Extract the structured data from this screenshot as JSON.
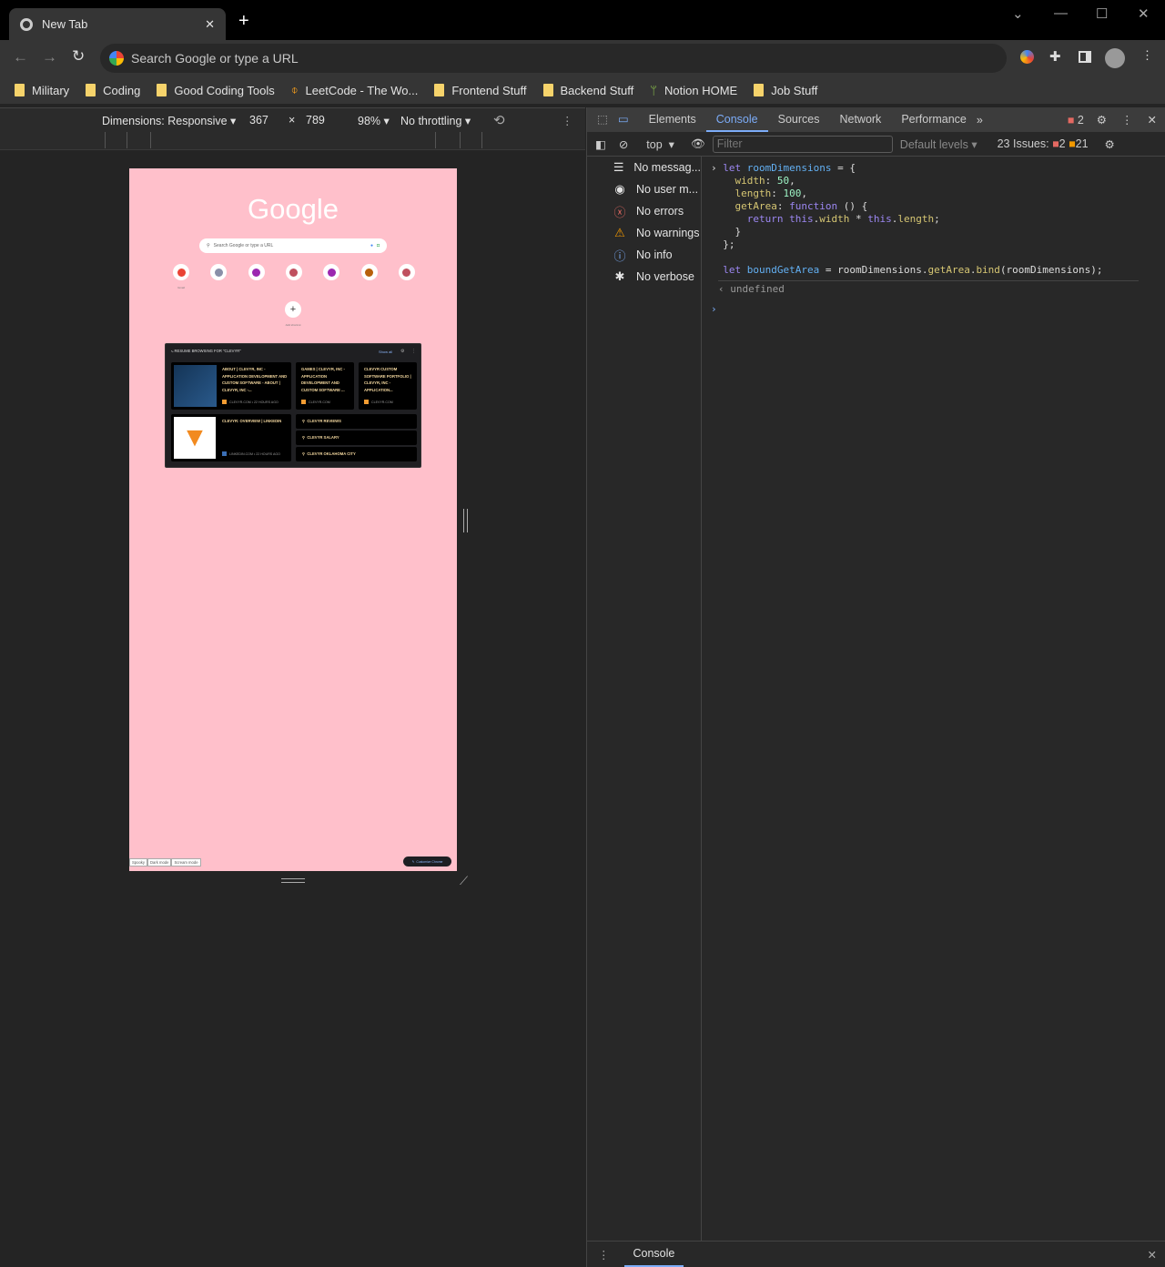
{
  "browser": {
    "tab_title": "New Tab",
    "omnibox_placeholder": "Search Google or type a URL",
    "bookmarks": [
      "Military",
      "Coding",
      "Good Coding Tools",
      "LeetCode - The Wo...",
      "Frontend Stuff",
      "Backend Stuff",
      "Notion HOME",
      "Job Stuff"
    ]
  },
  "device_toolbar": {
    "dimensions": "Dimensions: Responsive",
    "width": "367",
    "x": "×",
    "height": "789",
    "zoom": "98%",
    "throttling": "No throttling"
  },
  "page": {
    "logo": "Google",
    "search_placeholder": "Search Google or type a URL",
    "shortcuts": [
      {
        "label": "Gmail",
        "color": "#ea4335"
      },
      {
        "label": "",
        "color": "#8a8fa8"
      },
      {
        "label": "",
        "color": "#9c27b0"
      },
      {
        "label": "",
        "color": "#c0505f"
      },
      {
        "label": "",
        "color": "#9c27b0"
      },
      {
        "label": "",
        "color": "#b8600c"
      },
      {
        "label": "",
        "color": "#c0505f"
      }
    ],
    "add_shortcut": "Add shortcut",
    "resume": {
      "title": "RESUME BROWSING FOR \"CLEVYR\"",
      "show_all": "Show all",
      "items": [
        {
          "title": "ABOUT | CLEVYR, INC - APPLICATION DEVELOPMENT AND CUSTOM SOFTWARE - ABOUT | CLEVYR, INC -...",
          "meta": "CLEVYR.COM • 22 HOURS AGO"
        },
        {
          "title": "GAMES | CLEVYR, INC - APPLICATION DEVELOPMENT AND CUSTOM SOFTWARE ...",
          "meta": "CLEVYR.COM"
        },
        {
          "title": "CLEVYR CUSTOM SOFTWARE PORTFOLIO | CLEVYR, INC - APPLICATION...",
          "meta": "CLEVYR.COM"
        },
        {
          "title": "CLEVYR: OVERVIEW | LINKEDIN",
          "meta": "LINKEDIN.COM • 22 HOURS AGO"
        }
      ],
      "searches": [
        "CLEVYR REVIEWS",
        "CLEVYR SALARY",
        "CLEVYR OKLAHOMA CITY"
      ]
    },
    "footer_buttons": [
      "Spooky",
      "Dark mode",
      "Scream mode"
    ],
    "customize": "Customize Chrome"
  },
  "devtools": {
    "tabs": [
      "Elements",
      "Console",
      "Sources",
      "Network",
      "Performance"
    ],
    "active_tab": "Console",
    "error_badge": "2",
    "context": "top",
    "filter_placeholder": "Filter",
    "levels": "Default levels",
    "issues_label": "23 Issues:",
    "issues_errors": "2",
    "issues_warnings": "21",
    "sidebar": [
      {
        "icon": "list-icon",
        "label": "No messag..."
      },
      {
        "icon": "user-icon",
        "label": "No user m..."
      },
      {
        "icon": "error-icon",
        "label": "No errors"
      },
      {
        "icon": "warning-icon",
        "label": "No warnings"
      },
      {
        "icon": "info-icon",
        "label": "No info"
      },
      {
        "icon": "bug-icon",
        "label": "No verbose"
      }
    ],
    "console_result": "undefined",
    "drawer_tab": "Console"
  }
}
